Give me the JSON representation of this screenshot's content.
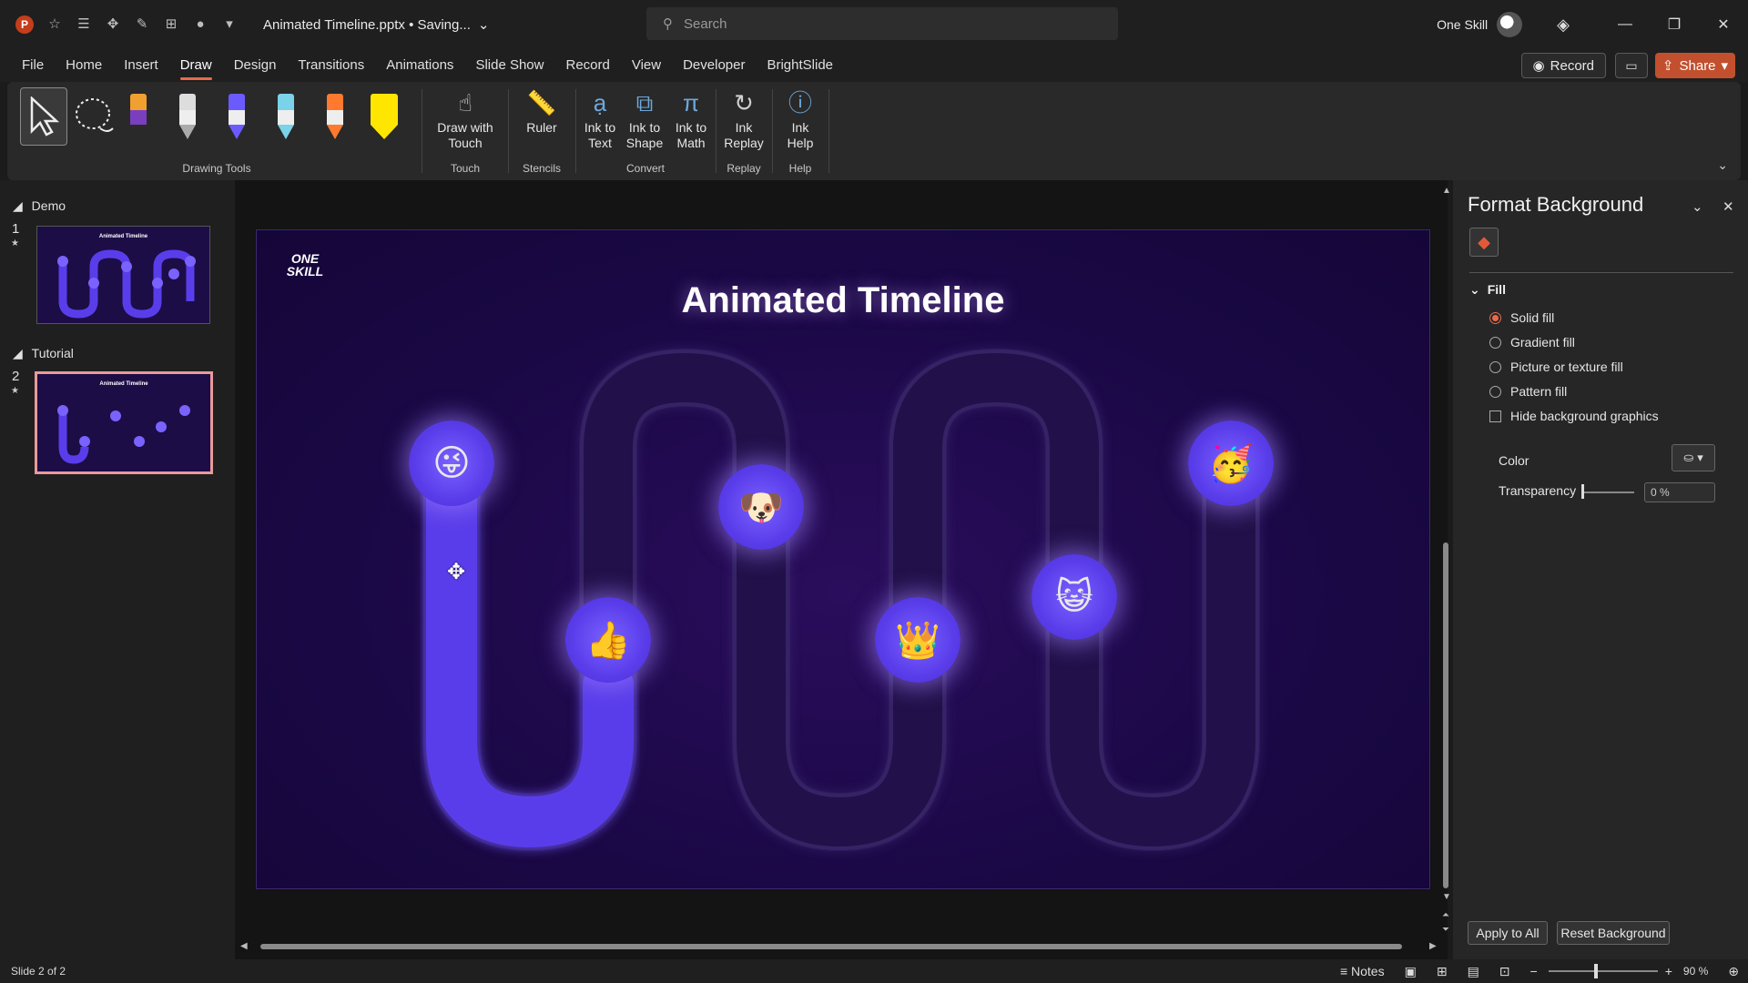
{
  "titlebar": {
    "document_title": "Animated Timeline.pptx • Saving...",
    "search_placeholder": "Search",
    "user_name": "One Skill",
    "minimize": "—",
    "restore": "❐",
    "close": "✕"
  },
  "menu": {
    "tabs": [
      "File",
      "Home",
      "Insert",
      "Draw",
      "Design",
      "Transitions",
      "Animations",
      "Slide Show",
      "Record",
      "View",
      "Developer",
      "BrightSlide"
    ],
    "active_tab": "Draw",
    "record_label": "Record",
    "share_label": "Share"
  },
  "ribbon": {
    "groups": {
      "drawing_tools": "Drawing Tools",
      "touch": "Touch",
      "stencils": "Stencils",
      "convert": "Convert",
      "replay": "Replay",
      "help": "Help"
    },
    "buttons": {
      "draw_with_touch": "Draw with Touch",
      "ruler": "Ruler",
      "ink_to_text": "Ink to Text",
      "ink_to_shape": "Ink to Shape",
      "ink_to_math": "Ink to Math",
      "ink_replay": "Ink Replay",
      "ink_help": "Ink Help"
    },
    "pen_colors": [
      "#7a3fbf",
      "#e0e0e0",
      "#6b5bff",
      "#7ad3e8",
      "#ff7a2e",
      "#ffe600"
    ]
  },
  "slides_panel": {
    "sections": [
      {
        "name": "Demo",
        "slide_number": "1",
        "thumb_title": "Animated Timeline"
      },
      {
        "name": "Tutorial",
        "slide_number": "2",
        "thumb_title": "Animated Timeline"
      }
    ]
  },
  "slide": {
    "title": "Animated Timeline",
    "logo_line1": "ONE",
    "logo_line2": "SKILL",
    "emojis": [
      "😜",
      "👍",
      "🐶",
      "👑",
      "😺",
      "🥳"
    ],
    "colors": {
      "background": "#1a0845",
      "path_active": "#5a3dea",
      "path_ghost": "#2a1655",
      "glow": "#a082ff"
    }
  },
  "format_background": {
    "title": "Format Background",
    "section": "Fill",
    "options": [
      {
        "label": "Solid fill",
        "selected": true
      },
      {
        "label": "Gradient fill",
        "selected": false
      },
      {
        "label": "Picture or texture fill",
        "selected": false
      },
      {
        "label": "Pattern fill",
        "selected": false
      }
    ],
    "hide_bg_graphics": "Hide background graphics",
    "color_label": "Color",
    "transparency_label": "Transparency",
    "transparency_value": "0 %",
    "apply_all": "Apply to All",
    "reset": "Reset Background"
  },
  "statusbar": {
    "slide_info": "Slide 2 of 2",
    "notes": "Notes",
    "zoom": "90 %"
  }
}
